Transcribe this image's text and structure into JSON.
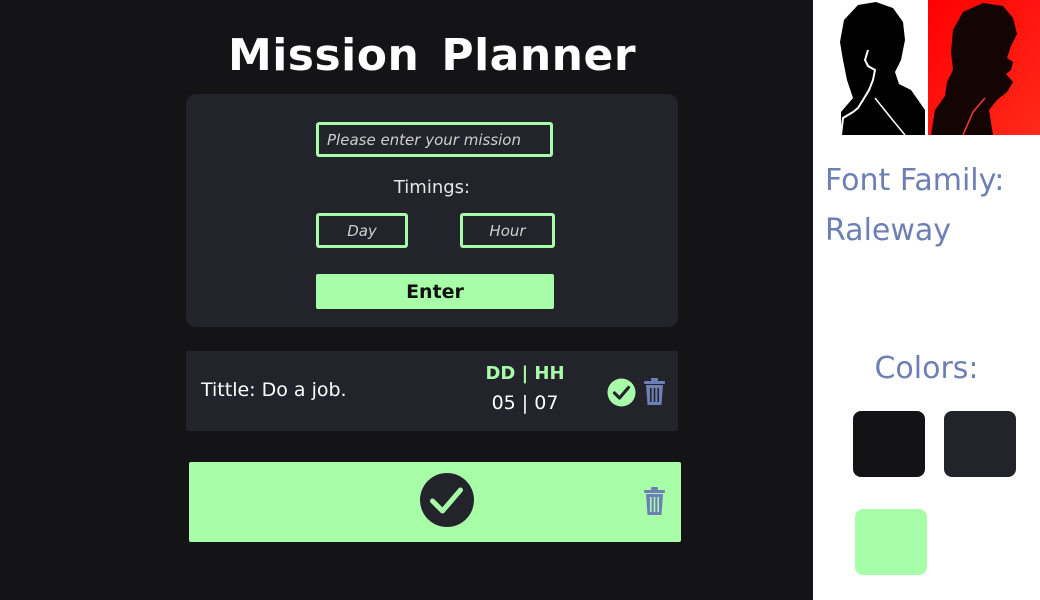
{
  "app": {
    "title_word1": "Mission",
    "title_word2": "Planner"
  },
  "form": {
    "mission_placeholder": "Please enter your mission",
    "timings_label": "Timings:",
    "day_placeholder": "Day",
    "hour_placeholder": "Hour",
    "enter_label": "Enter"
  },
  "mission": {
    "title": "Tittle: Do a job.",
    "time_header": "DD | HH",
    "time_values": "05 | 07",
    "done_icon": "check-circle-icon",
    "delete_icon": "trash-icon"
  },
  "completed": {
    "done_icon": "check-circle-icon",
    "delete_icon": "trash-icon"
  },
  "style_panel": {
    "font_heading": "Font Family:",
    "font_value": "Raleway",
    "colors_heading": "Colors:",
    "swatches": [
      "#131316",
      "#23232b",
      "#a8fda9"
    ]
  },
  "colors": {
    "background": "#141417",
    "card": "#23232b",
    "accent": "#a8fda9",
    "icon_blue": "#6d7fb5",
    "portrait_red": "#ff0000"
  }
}
